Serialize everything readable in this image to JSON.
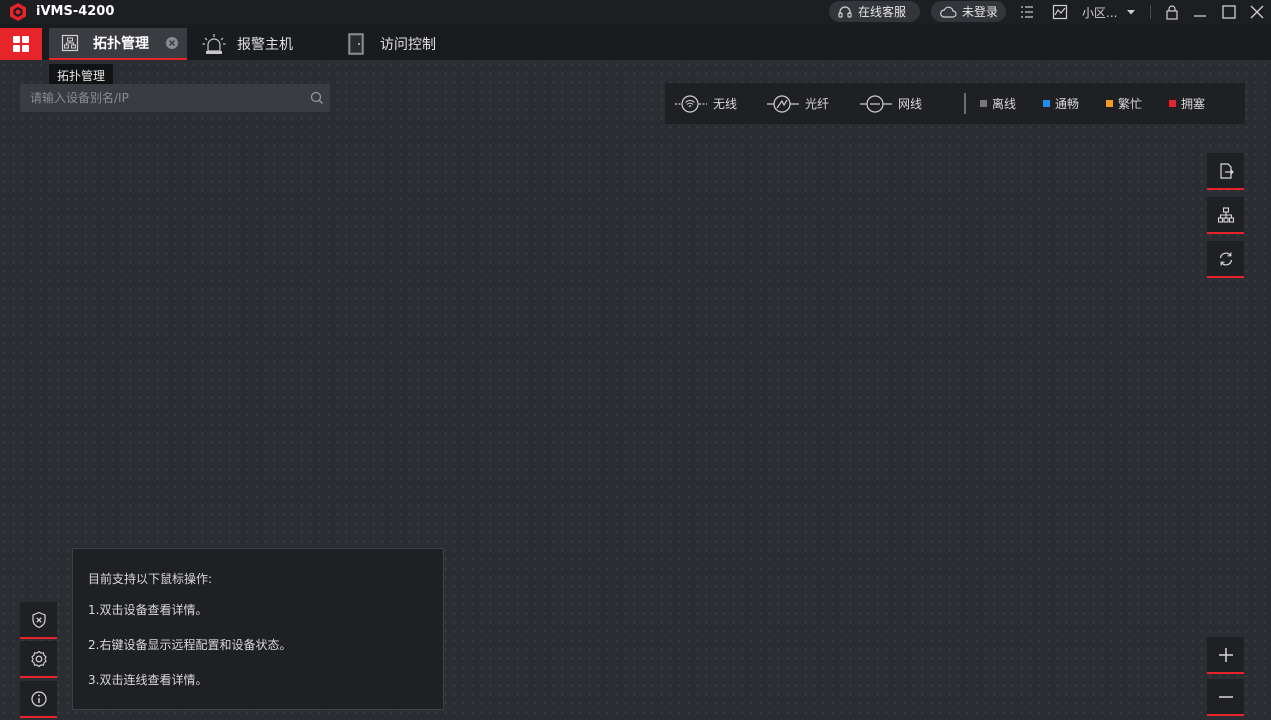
{
  "window": {
    "app_title": "iVMS-4200",
    "online_service_label": "在线客服",
    "login_status_label": "未登录",
    "community_label": "小区...",
    "icons": {
      "logo": "logo-icon",
      "headset": "headset-icon",
      "cloud": "cloud-icon",
      "list": "list-icon",
      "monitor": "monitor-icon",
      "dropdown": "chevron-down-icon",
      "lock": "lock-icon",
      "minimize": "minimize-icon",
      "maximize": "maximize-icon",
      "close": "close-icon"
    }
  },
  "tabs": [
    {
      "label": "拓扑管理",
      "icon": "topology-icon",
      "active": true,
      "closable": true
    },
    {
      "label": "报警主机",
      "icon": "alarm-siren-icon",
      "active": false
    },
    {
      "label": "访问控制",
      "icon": "door-icon",
      "active": false
    }
  ],
  "tooltip": {
    "text": "拓扑管理"
  },
  "search": {
    "placeholder": "请输入设备别名/IP",
    "value": ""
  },
  "legend": {
    "links": [
      {
        "label": "无线",
        "icon": "wireless-link-icon"
      },
      {
        "label": "光纤",
        "icon": "fiber-link-icon"
      },
      {
        "label": "网线",
        "icon": "cable-link-icon"
      }
    ],
    "statuses": [
      {
        "label": "离线",
        "color": "#777777"
      },
      {
        "label": "通畅",
        "color": "#1e8ff0"
      },
      {
        "label": "繁忙",
        "color": "#f59a23"
      },
      {
        "label": "拥塞",
        "color": "#e6242a"
      }
    ]
  },
  "right_tools": [
    {
      "name": "export-button",
      "icon": "export-file-icon"
    },
    {
      "name": "topology-layout-button",
      "icon": "org-tree-icon"
    },
    {
      "name": "refresh-button",
      "icon": "refresh-icon"
    }
  ],
  "zoom": {
    "in_icon": "plus-icon",
    "out_icon": "minus-icon"
  },
  "left_tools": [
    {
      "name": "security-button",
      "icon": "shield-icon"
    },
    {
      "name": "settings-button",
      "icon": "gear-icon"
    },
    {
      "name": "info-button",
      "icon": "info-icon"
    }
  ],
  "help": {
    "title": "目前支持以下鼠标操作:",
    "lines": [
      "1.双击设备查看详情。",
      "2.右键设备显示远程配置和设备状态。",
      "3.双击连线查看详情。"
    ]
  },
  "colors": {
    "accent": "#e6242a",
    "background": "#2b2d33",
    "panel": "#1f2024"
  }
}
